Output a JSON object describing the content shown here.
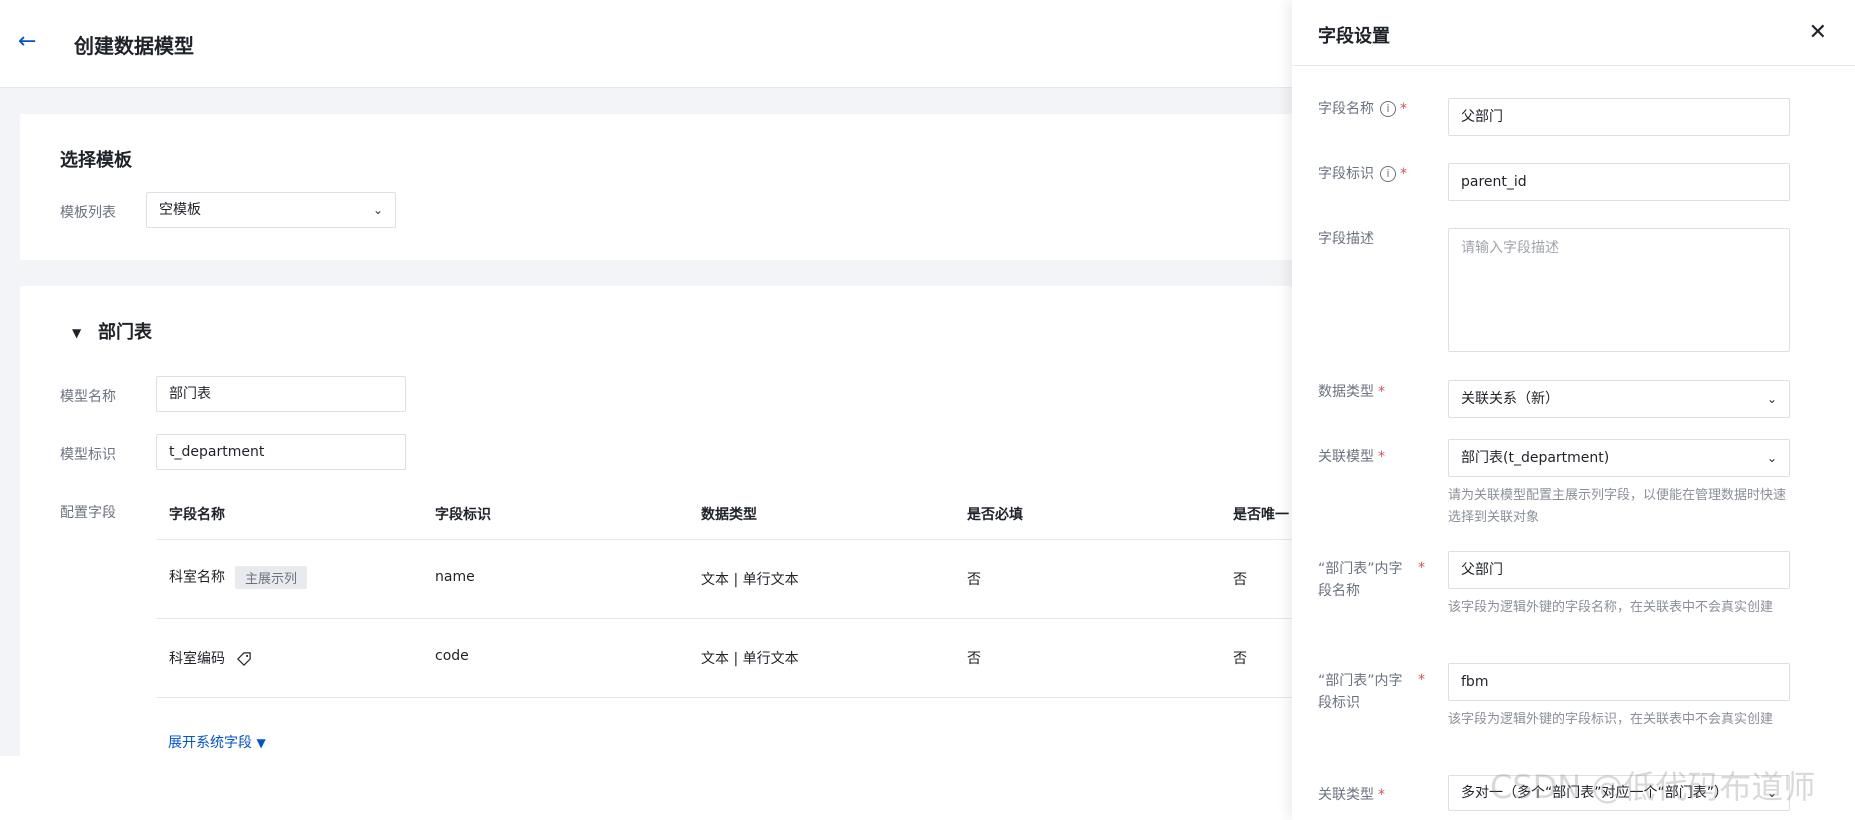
{
  "header": {
    "back_icon": "arrow-left-icon",
    "title": "创建数据模型"
  },
  "template_card": {
    "title": "选择模板",
    "list_label": "模板列表",
    "selected": "空模板"
  },
  "model_card": {
    "section_title": "部门表",
    "name_label": "模型名称",
    "name_value": "部门表",
    "id_label": "模型标识",
    "id_value": "t_department",
    "fields_label": "配置字段",
    "columns": [
      "字段名称",
      "字段标识",
      "数据类型",
      "是否必填",
      "是否唯一"
    ],
    "rows": [
      {
        "name": "科室名称",
        "tag": "主展示列",
        "id": "name",
        "type": "文本 | 单行文本",
        "required": "否",
        "unique": "否"
      },
      {
        "name": "科室编码",
        "id": "code",
        "type": "文本 | 单行文本",
        "required": "否",
        "unique": "否"
      }
    ],
    "expand_label": "展开系统字段"
  },
  "drawer": {
    "title": "字段设置",
    "field_name_label": "字段名称",
    "field_name_value": "父部门",
    "field_id_label": "字段标识",
    "field_id_value": "parent_id",
    "desc_label": "字段描述",
    "desc_placeholder": "请输入字段描述",
    "data_type_label": "数据类型",
    "data_type_value": "关联关系（新）",
    "rel_model_label": "关联模型",
    "rel_model_value": "部门表(t_department)",
    "rel_model_hint": "请为关联模型配置主展示列字段，以便能在管理数据时快速选择到关联对象",
    "inner_name_label_1": "“部门表”内字",
    "inner_name_label_2": "段名称",
    "inner_name_value": "父部门",
    "inner_name_hint": "该字段为逻辑外键的字段名称，在关联表中不会真实创建",
    "inner_id_label_1": "“部门表”内字",
    "inner_id_label_2": "段标识",
    "inner_id_value": "fbm",
    "inner_id_hint": "该字段为逻辑外键的字段标识，在关联表中不会真实创建",
    "rel_type_label": "关联类型",
    "rel_type_value": "多对一（多个“部门表”对应一个“部门表”）"
  },
  "watermark": "CSDN @低代码布道师"
}
